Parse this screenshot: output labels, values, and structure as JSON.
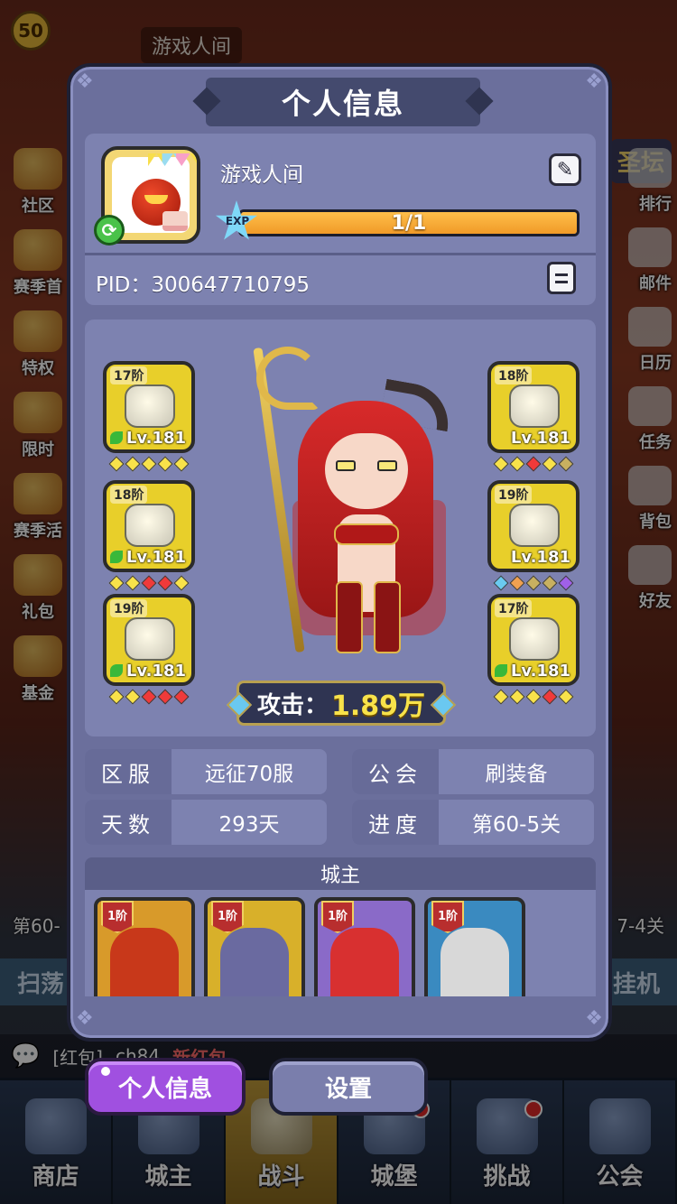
{
  "background": {
    "level": "50",
    "name": "游戏人间",
    "altar_label": "圣坛",
    "left_menu": [
      "社区",
      "赛季首",
      "特权",
      "限时",
      "赛季活",
      "礼包",
      "基金"
    ],
    "right_menu": [
      "排行",
      "邮件",
      "日历",
      "任务",
      "背包",
      "好友"
    ],
    "stage_left": "第60-",
    "stage_right": "7-4关",
    "sweep": "扫荡",
    "idle": "挂机",
    "chat": {
      "tag": "[红包]",
      "user": "ch84",
      "text": "新红包"
    }
  },
  "bottom_nav": [
    {
      "label": "商店",
      "badge": false
    },
    {
      "label": "城主",
      "badge": false
    },
    {
      "label": "战斗",
      "badge": false
    },
    {
      "label": "城堡",
      "badge": true
    },
    {
      "label": "挑战",
      "badge": true
    },
    {
      "label": "公会",
      "badge": false
    }
  ],
  "panel": {
    "title": "个人信息",
    "profile": {
      "name": "游戏人间",
      "exp_label": "EXP",
      "exp_text": "1/1",
      "exp_progress": 1.0,
      "pid": "PID：300647710795",
      "avatar_badge": "2"
    },
    "equipment": {
      "left": [
        {
          "tier": "17阶",
          "level": "Lv.181",
          "gems": [
            "y",
            "y",
            "y",
            "y",
            "y"
          ]
        },
        {
          "tier": "18阶",
          "level": "Lv.181",
          "gems": [
            "y",
            "y",
            "r",
            "r",
            "y"
          ]
        },
        {
          "tier": "19阶",
          "level": "Lv.181",
          "gems": [
            "y",
            "y",
            "r",
            "r",
            "r"
          ]
        }
      ],
      "right": [
        {
          "tier": "18阶",
          "level": "Lv.181",
          "gems": [
            "y",
            "y",
            "r",
            "y",
            "g"
          ]
        },
        {
          "tier": "19阶",
          "level": "Lv.181",
          "gems": [
            "b",
            "o",
            "g",
            "g",
            "p"
          ]
        },
        {
          "tier": "17阶",
          "level": "Lv.181",
          "gems": [
            "y",
            "y",
            "y",
            "r",
            "y"
          ]
        }
      ],
      "attack_label": "攻击：",
      "attack_value": "1.89万"
    },
    "info": [
      {
        "key": "区服",
        "value": "远征70服"
      },
      {
        "key": "公会",
        "value": "刷装备"
      },
      {
        "key": "天数",
        "value": "293天"
      },
      {
        "key": "进度",
        "value": "第60-5关"
      }
    ],
    "lord_title": "城主",
    "lords": [
      {
        "tier": "1阶",
        "bg": "#d89a2a",
        "art": "#c8381a"
      },
      {
        "tier": "1阶",
        "bg": "#d8b02a",
        "art": "#6a6aa0"
      },
      {
        "tier": "1阶",
        "bg": "#8a6ac8",
        "art": "#d83030"
      },
      {
        "tier": "1阶",
        "bg": "#3a8ac0",
        "art": "#d8d8d8"
      }
    ]
  },
  "tabs": {
    "info": "个人信息",
    "settings": "设置"
  }
}
